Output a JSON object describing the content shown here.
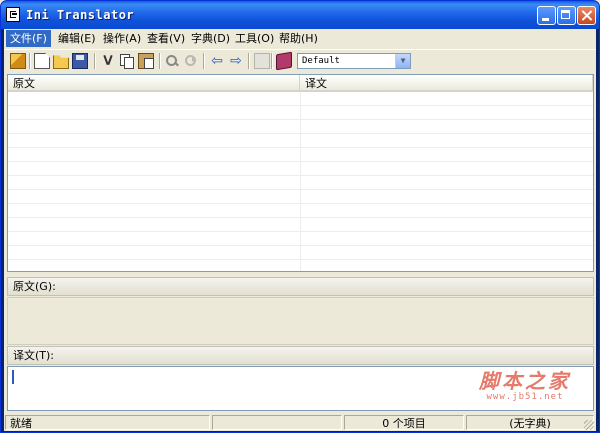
{
  "window": {
    "title": "Ini Translator"
  },
  "menu": {
    "file": "文件(F)",
    "edit": "编辑(E)",
    "operate": "操作(A)",
    "view": "查看(V)",
    "dictionary": "字典(D)",
    "tools": "工具(O)",
    "help": "帮助(H)"
  },
  "toolbar": {
    "profile_combo": {
      "selected": "Default"
    }
  },
  "grid": {
    "columns": [
      "原文",
      "译文"
    ],
    "rows": []
  },
  "panels": {
    "source_label": "原文(G):",
    "target_label": "译文(T):",
    "source_text": "",
    "target_text": ""
  },
  "watermark": {
    "main": "脚本之家",
    "sub": "www.jb51.net"
  },
  "status": {
    "ready": "就绪",
    "middle": "",
    "count": "0 个项目",
    "dictionary": "(无字典)"
  },
  "colors": {
    "title_bar": "#0a4ad2",
    "menu_highlight": "#316ac5",
    "watermark": "#e57b6a"
  }
}
